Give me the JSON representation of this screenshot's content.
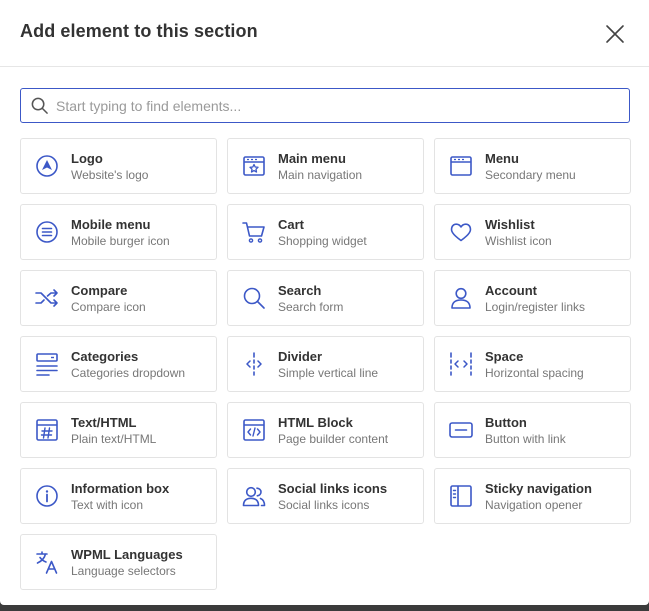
{
  "modal": {
    "title": "Add element to this section",
    "close_icon": "close-icon"
  },
  "search": {
    "placeholder": "Start typing to find elements...",
    "value": "",
    "icon": "search-icon"
  },
  "colors": {
    "accent": "#3c58c7",
    "title_text": "#333333",
    "description_text": "#777777",
    "card_border": "#e3e3e3"
  },
  "elements": [
    {
      "name": "Logo",
      "description": "Website's logo",
      "icon": "logo-icon"
    },
    {
      "name": "Main menu",
      "description": "Main navigation",
      "icon": "main-menu-icon"
    },
    {
      "name": "Menu",
      "description": "Secondary menu",
      "icon": "menu-icon"
    },
    {
      "name": "Mobile menu",
      "description": "Mobile burger icon",
      "icon": "mobile-menu-icon"
    },
    {
      "name": "Cart",
      "description": "Shopping widget",
      "icon": "cart-icon"
    },
    {
      "name": "Wishlist",
      "description": "Wishlist icon",
      "icon": "heart-icon"
    },
    {
      "name": "Compare",
      "description": "Compare icon",
      "icon": "shuffle-icon"
    },
    {
      "name": "Search",
      "description": "Search form",
      "icon": "search-icon"
    },
    {
      "name": "Account",
      "description": "Login/register links",
      "icon": "user-icon"
    },
    {
      "name": "Categories",
      "description": "Categories dropdown",
      "icon": "categories-icon"
    },
    {
      "name": "Divider",
      "description": "Simple vertical line",
      "icon": "divider-icon"
    },
    {
      "name": "Space",
      "description": "Horizontal spacing",
      "icon": "space-icon"
    },
    {
      "name": "Text/HTML",
      "description": "Plain text/HTML",
      "icon": "text-html-icon"
    },
    {
      "name": "HTML Block",
      "description": "Page builder content",
      "icon": "code-block-icon"
    },
    {
      "name": "Button",
      "description": "Button with link",
      "icon": "button-icon"
    },
    {
      "name": "Information box",
      "description": "Text with icon",
      "icon": "info-icon"
    },
    {
      "name": "Social links icons",
      "description": "Social links icons",
      "icon": "users-icon"
    },
    {
      "name": "Sticky navigation",
      "description": "Navigation opener",
      "icon": "sidebar-icon"
    },
    {
      "name": "WPML Languages",
      "description": "Language selectors",
      "icon": "translate-icon"
    }
  ]
}
